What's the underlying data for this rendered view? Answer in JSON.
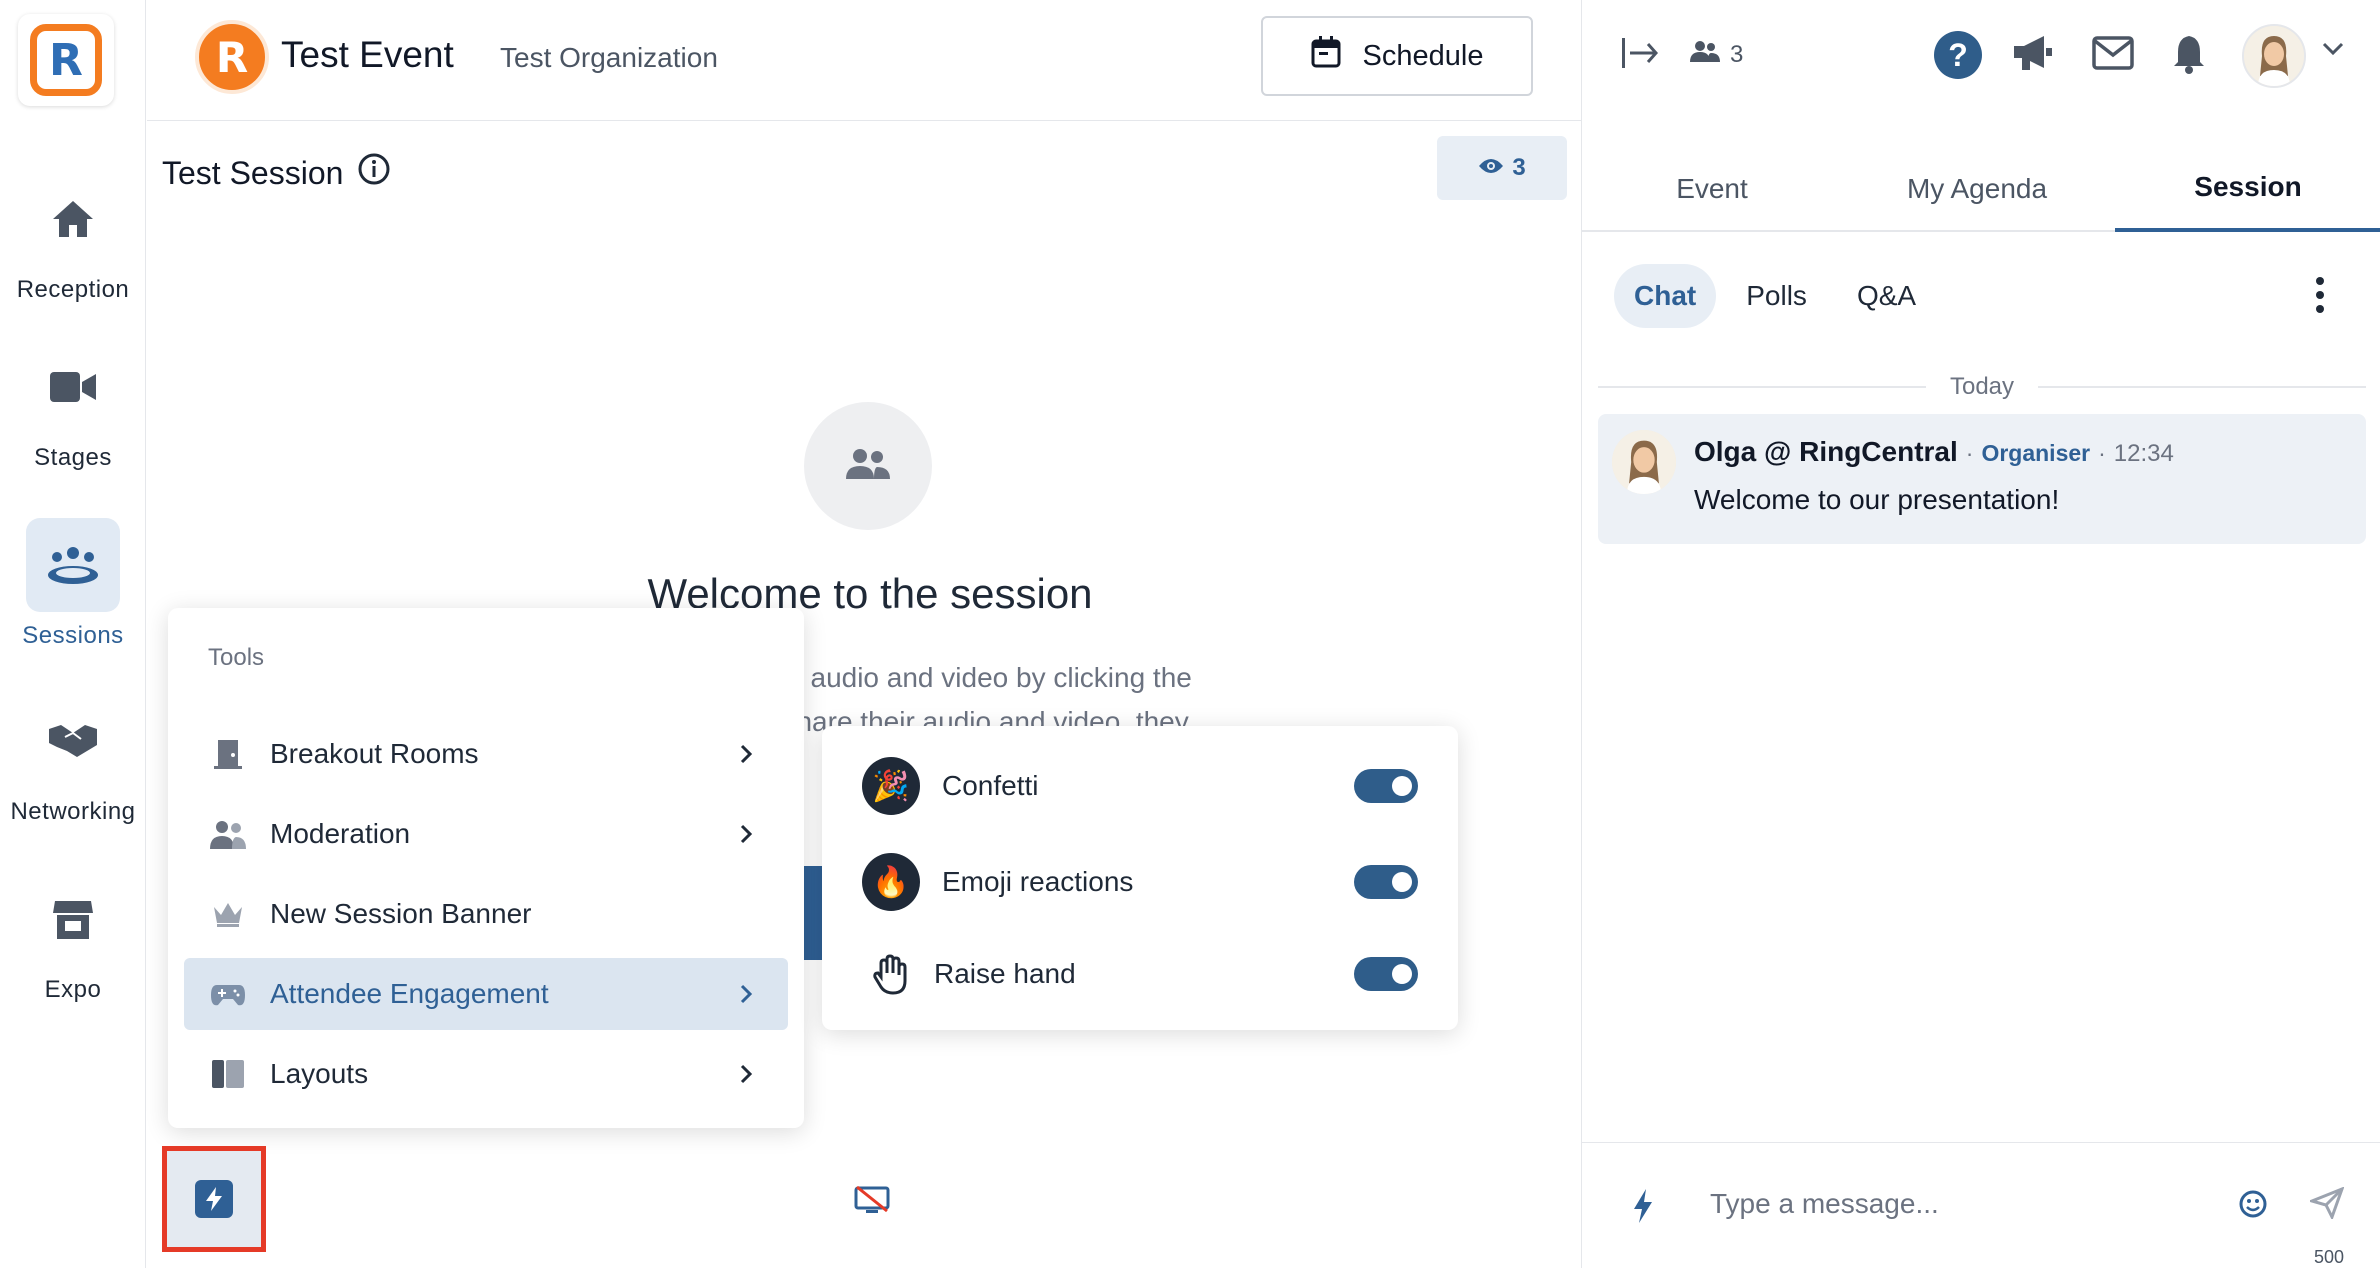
{
  "nav": {
    "logo_letter": "R",
    "items": [
      {
        "label": "Reception",
        "icon": "home-icon"
      },
      {
        "label": "Stages",
        "icon": "video-camera-icon"
      },
      {
        "label": "Sessions",
        "icon": "group-icon"
      },
      {
        "label": "Networking",
        "icon": "handshake-icon"
      },
      {
        "label": "Expo",
        "icon": "booth-icon"
      }
    ],
    "active": "Sessions"
  },
  "header": {
    "event_avatar_letter": "R",
    "event_title": "Test Event",
    "organization": "Test Organization",
    "schedule_label": "Schedule"
  },
  "session": {
    "title": "Test Session",
    "viewer_count": "3",
    "welcome_title": "Welcome to the session",
    "welcome_text_line1": "are your audio and video by clicking the",
    "welcome_text_line2": "ask to share their audio and video, they"
  },
  "tools_menu": {
    "header": "Tools",
    "items": [
      {
        "label": "Breakout Rooms",
        "icon": "door-icon",
        "has_submenu": true
      },
      {
        "label": "Moderation",
        "icon": "people-icon",
        "has_submenu": true
      },
      {
        "label": "New Session Banner",
        "icon": "crown-icon",
        "has_submenu": false
      },
      {
        "label": "Attendee Engagement",
        "icon": "gamepad-icon",
        "has_submenu": true
      },
      {
        "label": "Layouts",
        "icon": "layout-icon",
        "has_submenu": true
      }
    ],
    "active": "Attendee Engagement"
  },
  "engagement_menu": {
    "items": [
      {
        "label": "Confetti",
        "icon": "confetti-icon",
        "enabled": true
      },
      {
        "label": "Emoji reactions",
        "icon": "emoji-icon",
        "enabled": true
      },
      {
        "label": "Raise hand",
        "icon": "hand-icon",
        "enabled": true
      }
    ]
  },
  "right_panel": {
    "attendee_count": "3",
    "help_label": "?",
    "tabs": [
      "Event",
      "My Agenda",
      "Session"
    ],
    "active_tab": "Session",
    "subtabs": [
      "Chat",
      "Polls",
      "Q&A"
    ],
    "active_subtab": "Chat",
    "date_divider": "Today",
    "messages": [
      {
        "author": "Olga @ RingCentral",
        "role": "Organiser",
        "separator": "·",
        "time": "12:34",
        "text": "Welcome to our presentation!"
      }
    ],
    "composer": {
      "placeholder": "Type a message...",
      "char_limit": "500"
    }
  },
  "colors": {
    "accent": "#2f6095",
    "brand_orange": "#f47c20",
    "highlight_frame": "#e53a27"
  }
}
